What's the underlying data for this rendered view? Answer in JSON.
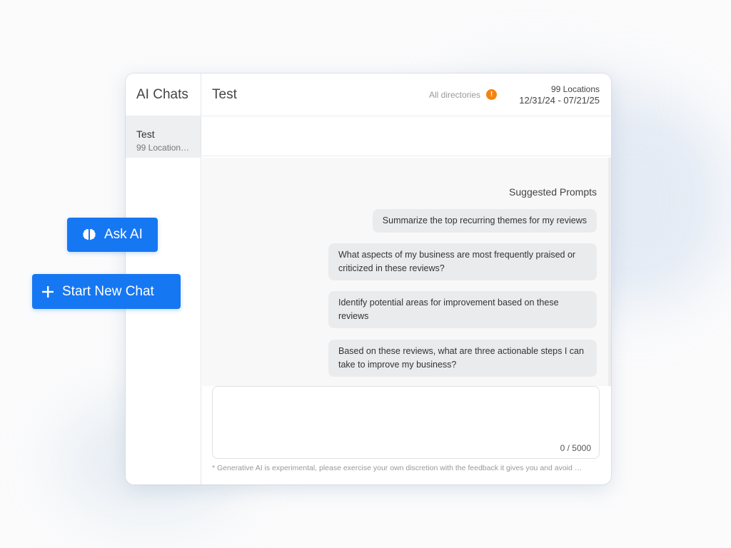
{
  "sidebar": {
    "title": "AI Chats",
    "chats": [
      {
        "title": "Test",
        "subtitle": "99 Location…"
      }
    ]
  },
  "header": {
    "title": "Test",
    "directories": "All directories",
    "warning_glyph": "!",
    "locations": "99 Locations",
    "date_range": "12/31/24 - 07/21/25"
  },
  "suggested": {
    "title": "Suggested Prompts",
    "prompts": [
      "Summarize the top recurring themes for my reviews",
      "What aspects of my business are most frequently praised or criticized in these reviews?",
      "Identify potential areas for improvement based on these reviews",
      "Based on these reviews, what are three actionable steps I can take to improve my business?"
    ]
  },
  "composer": {
    "counter": "0 / 5000",
    "disclaimer": "* Generative AI is experimental, please exercise your own discretion with the feedback it gives you and avoid …"
  },
  "buttons": {
    "ask_ai": "Ask AI",
    "start_new_chat": "Start New Chat"
  },
  "colors": {
    "accent": "#1677f2",
    "warning": "#f5830f",
    "prompt_bg": "#eaebed"
  },
  "icons": {
    "ask_ai": "brain-icon",
    "start_new_chat": "plus-icon",
    "warning": "warning-icon"
  }
}
